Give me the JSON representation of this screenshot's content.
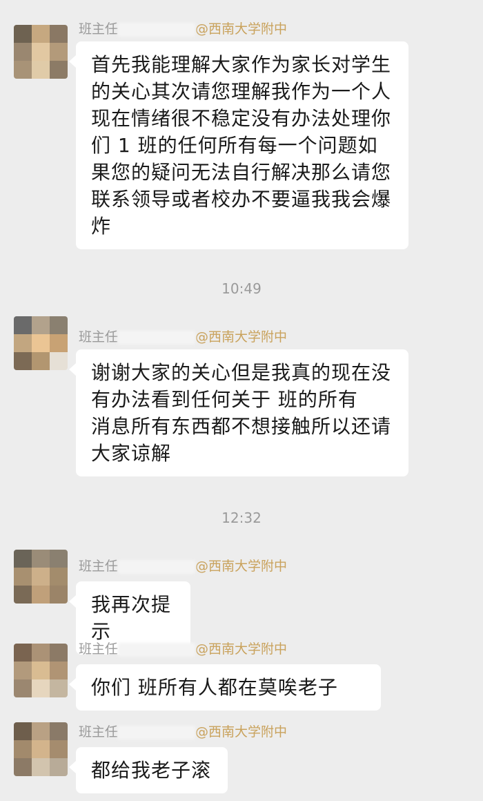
{
  "colors": {
    "background": "#ededed",
    "bubble": "#ffffff",
    "sender_name": "#9a9a9a",
    "sender_org": "#c9a25c"
  },
  "messages": [
    {
      "sender_name": "班主任",
      "sender_org": "@西南大学附中",
      "lines": [
        "首先我能理解大家作为家长对学生",
        "的关心其次请您理解我作为一个人",
        "现在情绪很不稳定没有办法处理你",
        "们 1  班的任何所有每一个问题如",
        "果您的疑问无法自行解决那么请您",
        "联系领导或者校办不要逼我我会爆",
        "炸"
      ]
    },
    {
      "timestamp": "10:49"
    },
    {
      "sender_name": "班主任",
      "sender_org": "@西南大学附中",
      "lines": [
        "谢谢大家的关心但是我真的现在没",
        "有办法看到任何关于   班的所有",
        "消息所有东西都不想接触所以还请",
        "大家谅解"
      ]
    },
    {
      "timestamp": "12:32"
    },
    {
      "sender_name": "班主任",
      "sender_org": "@西南大学附中",
      "lines": [
        "我再次提示"
      ]
    },
    {
      "sender_name": "班主任",
      "sender_org": "@西南大学附中",
      "lines": [
        "你们   班所有人都在莫唉老子"
      ]
    },
    {
      "sender_name": "班主任",
      "sender_org": "@西南大学附中",
      "lines": [
        "都给我老子滚"
      ]
    }
  ]
}
